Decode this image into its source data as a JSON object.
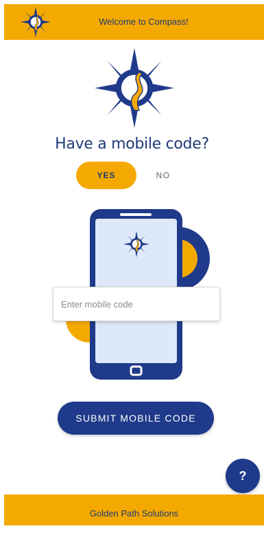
{
  "header": {
    "title": "Welcome to Compass!",
    "logo_icon": "compass-rose-icon"
  },
  "main": {
    "logo_icon": "compass-rose-icon",
    "heading": "Have a mobile code?",
    "toggle": {
      "yes_label": "YES",
      "no_label": "NO",
      "selected": "YES"
    },
    "illustration_icon": "phone-illustration-icon",
    "code_input": {
      "placeholder": "Enter mobile code",
      "value": ""
    },
    "submit_label": "SUBMIT MOBILE CODE"
  },
  "help": {
    "label": "?"
  },
  "footer": {
    "text": "Golden Path Solutions"
  },
  "colors": {
    "gold": "#f4a900",
    "navy": "#1f3a8a",
    "light_blue": "#dde8f8"
  }
}
